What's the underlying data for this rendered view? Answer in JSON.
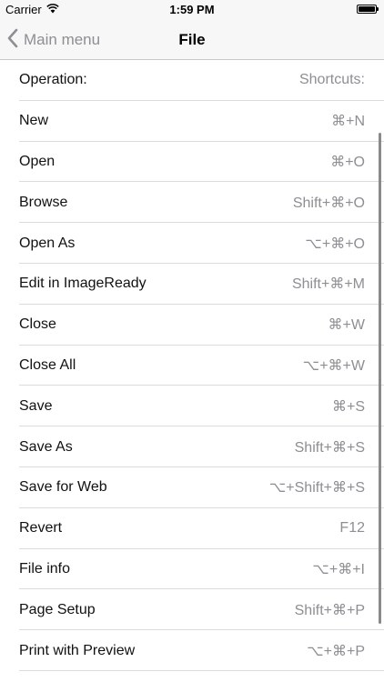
{
  "status_bar": {
    "carrier": "Carrier",
    "time": "1:59 PM",
    "battery_level": 1.0
  },
  "nav": {
    "back_label": "Main menu",
    "title": "File"
  },
  "list": {
    "header": {
      "operation": "Operation:",
      "shortcut": "Shortcuts:"
    },
    "rows": [
      {
        "operation": "New",
        "shortcut": "⌘+N"
      },
      {
        "operation": "Open",
        "shortcut": "⌘+O"
      },
      {
        "operation": "Browse",
        "shortcut": "Shift+⌘+O"
      },
      {
        "operation": "Open As",
        "shortcut": "⌥+⌘+O"
      },
      {
        "operation": "Edit in ImageReady",
        "shortcut": "Shift+⌘+M"
      },
      {
        "operation": "Close",
        "shortcut": "⌘+W"
      },
      {
        "operation": "Close All",
        "shortcut": "⌥+⌘+W"
      },
      {
        "operation": "Save",
        "shortcut": "⌘+S"
      },
      {
        "operation": "Save As",
        "shortcut": "Shift+⌘+S"
      },
      {
        "operation": "Save for Web",
        "shortcut": "⌥+Shift+⌘+S"
      },
      {
        "operation": "Revert",
        "shortcut": "F12"
      },
      {
        "operation": "File info",
        "shortcut": "⌥+⌘+I"
      },
      {
        "operation": "Page Setup",
        "shortcut": "Shift+⌘+P"
      },
      {
        "operation": "Print with Preview",
        "shortcut": "⌥+⌘+P"
      }
    ]
  },
  "colors": {
    "bar_background": "#f7f7f7",
    "secondary_text": "#8e8e93",
    "separator": "#dcdcdf"
  }
}
